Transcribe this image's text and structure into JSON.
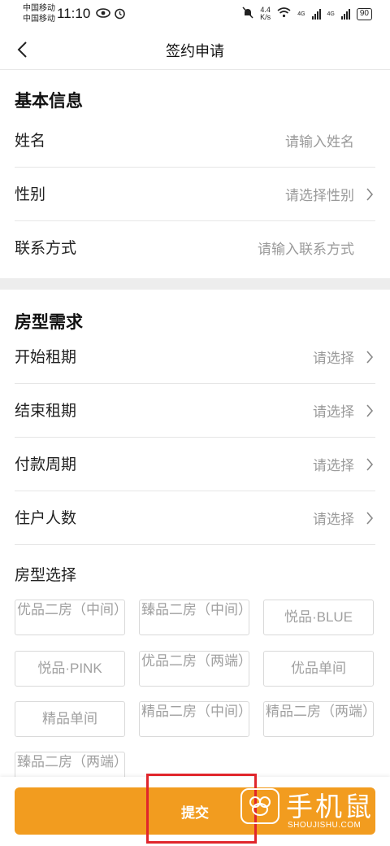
{
  "status_bar": {
    "carrier_1": "中国移动",
    "carrier_2": "中国移动",
    "time": "11:10",
    "speed_value": "4.4",
    "speed_unit": "K/s",
    "net_1": "4G",
    "net_2": "4G",
    "battery": "90",
    "icons": [
      "eye-icon",
      "alarm-icon",
      "mute-icon",
      "wifi-icon",
      "signal-icon",
      "battery-icon"
    ]
  },
  "header": {
    "title": "签约申请",
    "back_icon": "chevron-left-icon"
  },
  "basic_info": {
    "title": "基本信息",
    "rows": [
      {
        "label": "姓名",
        "placeholder": "请输入姓名",
        "has_chevron": false
      },
      {
        "label": "性别",
        "placeholder": "请选择性别",
        "has_chevron": true
      },
      {
        "label": "联系方式",
        "placeholder": "请输入联系方式",
        "has_chevron": false
      }
    ]
  },
  "room_needs": {
    "title": "房型需求",
    "rows": [
      {
        "label": "开始租期",
        "placeholder": "请选择"
      },
      {
        "label": "结束租期",
        "placeholder": "请选择"
      },
      {
        "label": "付款周期",
        "placeholder": "请选择"
      },
      {
        "label": "住户人数",
        "placeholder": "请选择"
      }
    ],
    "room_type_label": "房型选择",
    "room_types": [
      "优品二房（中间）",
      "臻品二房（中间）",
      "悦品·BLUE",
      "悦品·PINK",
      "优品二房（两端）",
      "优品单间",
      "精品单间",
      "精品二房（中间）",
      "精品二房（两端）",
      "臻品二房（两端）"
    ]
  },
  "footer": {
    "submit_label": "提交"
  },
  "watermark": {
    "text": "手机鼠",
    "url": "SHOUJISHU.COM"
  },
  "colors": {
    "accent": "#f29c1f",
    "highlight": "#e0262c",
    "placeholder": "#9a9a9a",
    "divider": "#e6e6e6"
  }
}
